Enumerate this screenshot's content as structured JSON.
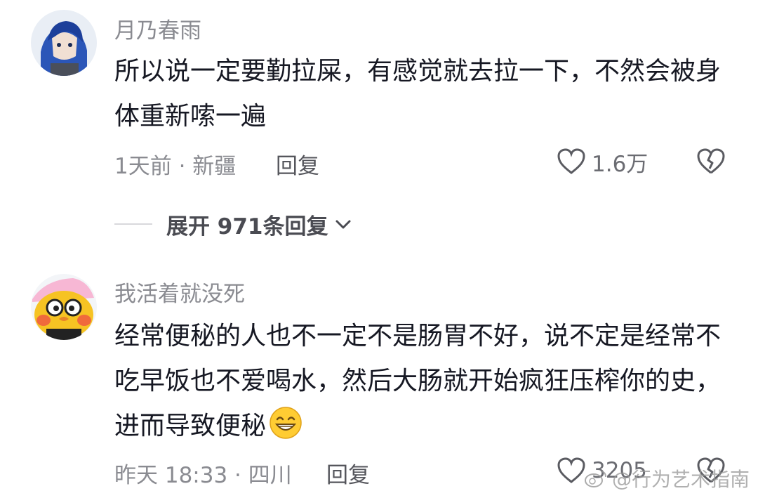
{
  "comments": [
    {
      "username": "月乃春雨",
      "text": "所以说一定要勤拉屎，有感觉就去拉一下，不然会被身体重新嗦一遍",
      "meta": "1天前 · 新疆",
      "reply_label": "回复",
      "like_count": "1.6万"
    },
    {
      "username": "我活着就没死",
      "text": "经常便秘的人也不一定不是肠胃不好，说不定是经常不吃早饭也不爱喝水，然后大肠就开始疯狂压榨你的史，进而导致便秘",
      "meta": "昨天 18:33 · 四川",
      "reply_label": "回复",
      "like_count": "3205"
    }
  ],
  "expand_replies": {
    "label": "展开 971条回复"
  },
  "watermark": {
    "text": "@行为艺术指南"
  },
  "icons": {
    "heart": "heart-icon",
    "dislike": "broken-heart-icon",
    "chevron": "chevron-down-icon",
    "emoji": "grinning-emoji-icon"
  }
}
